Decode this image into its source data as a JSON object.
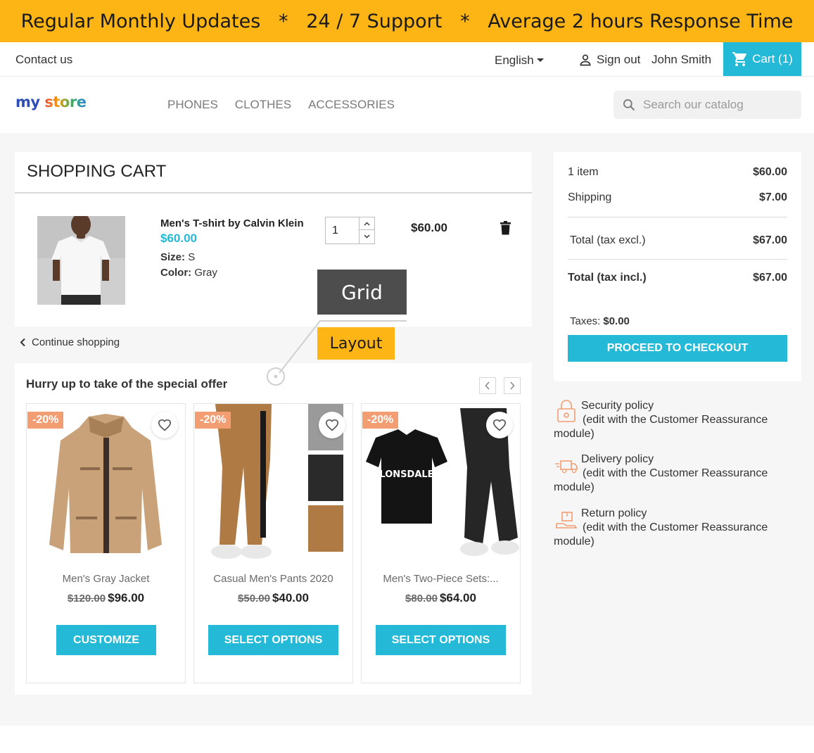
{
  "banner": {
    "text": "Regular Monthly Updates   *   24 / 7 Support   *   Average 2 hours Response Time"
  },
  "topnav": {
    "contact": "Contact us",
    "language": "English",
    "signout": "Sign out",
    "username": "John Smith",
    "cart": "Cart (1)"
  },
  "header": {
    "logo_word1": "my",
    "logo_word2": "store",
    "menu": [
      "PHONES",
      "CLOTHES",
      "ACCESSORIES"
    ],
    "search_placeholder": "Search our catalog"
  },
  "cart": {
    "title": "SHOPPING CART",
    "item": {
      "name": "Men's T-shirt by Calvin Klein",
      "price": "$60.00",
      "size_label": "Size:",
      "size_value": "S",
      "color_label": "Color:",
      "color_value": "Gray",
      "quantity": "1",
      "line_total": "$60.00"
    },
    "continue": "Continue shopping"
  },
  "offer": {
    "title": "Hurry up to take of the special offer",
    "products": [
      {
        "badge": "-20%",
        "name": "Men's Gray Jacket",
        "old_price": "$120.00",
        "price": "$96.00",
        "cta": "CUSTOMIZE"
      },
      {
        "badge": "-20%",
        "name": "Casual Men's Pants 2020",
        "old_price": "$50.00",
        "price": "$40.00",
        "cta": "SELECT OPTIONS"
      },
      {
        "badge": "-20%",
        "name": "Men's Two-Piece Sets:...",
        "old_price": "$80.00",
        "price": "$64.00",
        "cta": "SELECT OPTIONS"
      }
    ]
  },
  "summary": {
    "items_label": "1 item",
    "items_value": "$60.00",
    "shipping_label": "Shipping",
    "shipping_value": "$7.00",
    "total_excl_label": "Total (tax excl.)",
    "total_excl_value": "$67.00",
    "total_incl_label": "Total (tax incl.)",
    "total_incl_value": "$67.00",
    "taxes_label": "Taxes:",
    "taxes_value": "$0.00",
    "checkout": "PROCEED TO CHECKOUT"
  },
  "reassurance": [
    {
      "title": "Security policy",
      "desc": "(edit with the Customer Reassurance",
      "tail": "module)",
      "icon": "security-lock-icon"
    },
    {
      "title": "Delivery policy",
      "desc": "(edit with the Customer Reassurance",
      "tail": "module)",
      "icon": "delivery-truck-icon"
    },
    {
      "title": "Return policy",
      "desc": "(edit with the Customer Reassurance",
      "tail": "module)",
      "icon": "return-box-icon"
    }
  ],
  "annotations": {
    "grid": "Grid",
    "layout": "Layout"
  },
  "colors": {
    "banner": "#fdb515",
    "accent": "#24b9d7",
    "badge": "#f39d72",
    "annotation_dark": "#4d4d4d"
  }
}
